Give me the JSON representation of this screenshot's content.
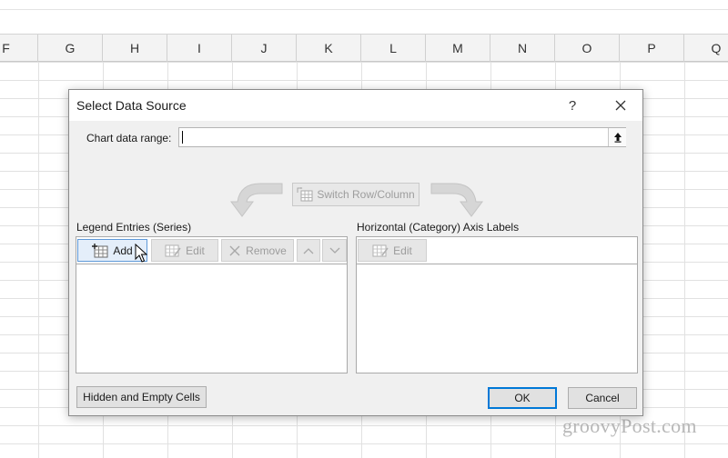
{
  "sheet": {
    "columns": [
      "F",
      "G",
      "H",
      "I",
      "J",
      "K",
      "L",
      "M",
      "N",
      "O",
      "P",
      "Q"
    ]
  },
  "watermark": "groovyPost.com",
  "dialog": {
    "title": "Select Data Source",
    "help_label": "?",
    "range_label": "Chart data range:",
    "range_value": "",
    "switch_label": "Switch Row/Column",
    "legend_section_label": "Legend Entries (Series)",
    "axis_section_label": "Horizontal (Category) Axis Labels",
    "legend_toolbar": {
      "add_label": "Add",
      "edit_label": "Edit",
      "remove_label": "Remove"
    },
    "axis_toolbar": {
      "edit_label": "Edit"
    },
    "hidden_cells_label": "Hidden and Empty Cells",
    "ok_label": "OK",
    "cancel_label": "Cancel"
  },
  "colors": {
    "accent": "#0078d7",
    "dialog_bg": "#f0f0f0",
    "disabled_text": "#9d9d9d"
  },
  "icons": [
    "upload-arrow-icon",
    "switch-row-column-icon",
    "add-table-icon",
    "edit-table-icon",
    "remove-x-icon",
    "chevron-up-icon",
    "chevron-down-icon",
    "close-icon",
    "mouse-pointer-icon",
    "curved-arrow-left-icon",
    "curved-arrow-right-icon"
  ]
}
